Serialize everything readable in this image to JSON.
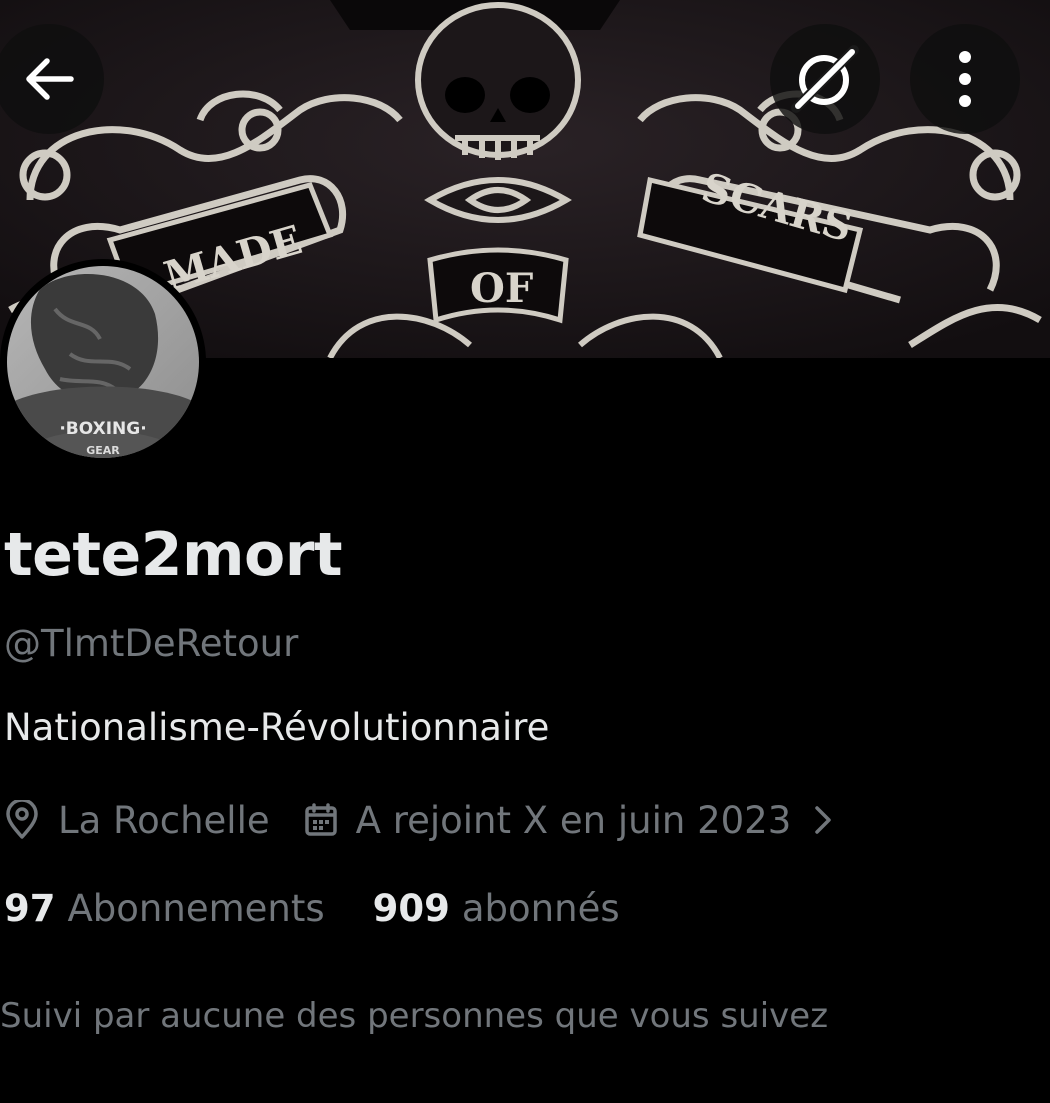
{
  "header": {
    "back_icon": "arrow-left-icon",
    "grok_icon": "grok-icon",
    "more_icon": "more-vertical-icon",
    "banner_words": [
      "MADE",
      "OF",
      "SCARS"
    ],
    "avatar_text": [
      "·BOXING·",
      "GEAR"
    ]
  },
  "profile": {
    "display_name": "tete2mort",
    "handle": "@TlmtDeRetour",
    "bio": "Nationalisme-Révolutionnaire",
    "location": "La Rochelle",
    "location_icon": "location-pin-icon",
    "joined": "A rejoint X en juin 2023",
    "joined_icon": "calendar-icon",
    "joined_chevron_icon": "chevron-right-icon",
    "following_count": "97",
    "following_label": "Abonnements",
    "followers_count": "909",
    "followers_label": "abonnés",
    "followed_by": "Suivi par aucune des personnes que vous suivez"
  },
  "colors": {
    "background": "#000000",
    "primary_text": "#e7e9ea",
    "secondary_text": "#71767b"
  }
}
